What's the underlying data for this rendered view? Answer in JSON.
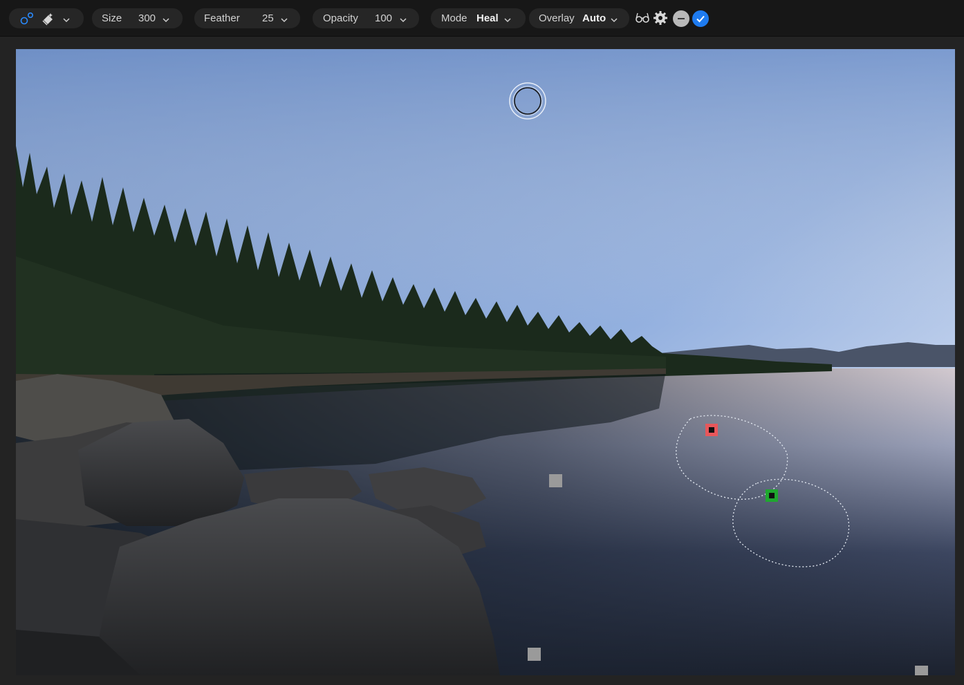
{
  "toolbar": {
    "tool_icon": "clone-spot-icon",
    "brush_icon": "brush-eraser-icon",
    "size": {
      "label": "Size",
      "value": "300"
    },
    "feather": {
      "label": "Feather",
      "value": "25"
    },
    "opacity": {
      "label": "Opacity",
      "value": "100"
    },
    "mode": {
      "label": "Mode",
      "value": "Heal"
    },
    "overlay": {
      "label": "Overlay",
      "value": "Auto"
    },
    "icons": [
      "glasses-icon",
      "gear-icon",
      "cancel-icon",
      "apply-check-icon"
    ]
  },
  "colors": {
    "accent_blue": "#1e7bf0",
    "source_marker": "#e8575b",
    "target_marker": "#1fa82f",
    "toolbar_bg": "#171717"
  }
}
